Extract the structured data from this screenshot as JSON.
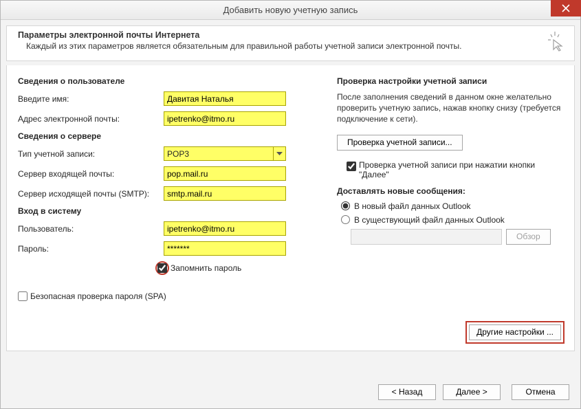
{
  "window": {
    "title": "Добавить новую учетную запись"
  },
  "header": {
    "title": "Параметры электронной почты Интернета",
    "subtitle": "Каждый из этих параметров является обязательным для правильной работы учетной записи электронной почты."
  },
  "left": {
    "user_section": "Сведения о пользователе",
    "name_label": "Введите имя:",
    "name_value": "Давитая Наталья",
    "email_label": "Адрес электронной почты:",
    "email_value": "ipetrenko@itmo.ru",
    "server_section": "Сведения о сервере",
    "account_type_label": "Тип учетной записи:",
    "account_type_value": "POP3",
    "incoming_label": "Сервер входящей почты:",
    "incoming_value": "pop.mail.ru",
    "outgoing_label": "Сервер исходящей почты (SMTP):",
    "outgoing_value": "smtp.mail.ru",
    "login_section": "Вход в систему",
    "user_label": "Пользователь:",
    "user_value": "ipetrenko@itmo.ru",
    "password_label": "Пароль:",
    "password_value": "*******",
    "remember_label": "Запомнить пароль",
    "spa_label": "Безопасная проверка пароля (SPA)"
  },
  "right": {
    "test_section": "Проверка настройки учетной записи",
    "test_text": "После заполнения сведений в данном окне желательно проверить учетную запись, нажав кнопку снизу (требуется подключение к сети).",
    "test_button": "Проверка учетной записи...",
    "test_on_next": "Проверка учетной записи при нажатии кнопки \"Далее\"",
    "deliver_section": "Доставлять новые сообщения:",
    "radio_new": "В новый файл данных Outlook",
    "radio_existing": "В существующий файл данных Outlook",
    "browse_button": "Обзор",
    "other_settings_button": "Другие настройки ..."
  },
  "footer": {
    "back": "< Назад",
    "next": "Далее >",
    "cancel": "Отмена"
  }
}
